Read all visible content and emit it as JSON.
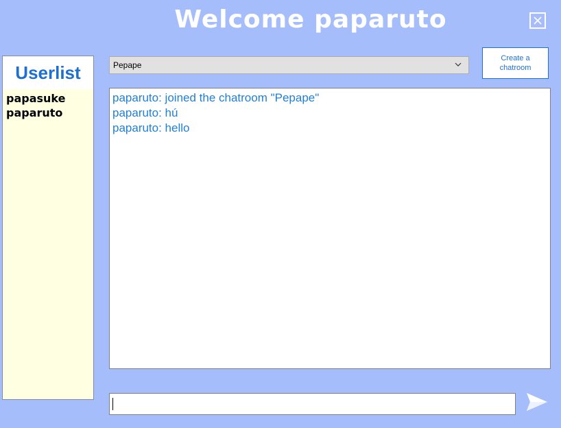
{
  "header": {
    "title": "Welcome paparuto"
  },
  "window": {
    "close_icon": "close-icon"
  },
  "userlist": {
    "title": "Userlist",
    "users": [
      "papasuke",
      "paparuto"
    ]
  },
  "chatroom_select": {
    "selected": "Pepape",
    "icon": "chevron-down-icon"
  },
  "create_button": {
    "label_line1": "Create a",
    "label_line2": "chatroom"
  },
  "messages": [
    "paparuto: joined the chatroom \"Pepape\"",
    "paparuto: hú",
    "paparuto: hello"
  ],
  "message_input": {
    "value": ""
  },
  "send": {
    "icon": "send-icon"
  },
  "colors": {
    "background": "#a6bdfc",
    "accent": "#1f6fd1",
    "message_text": "#1f7fd6",
    "userlist_bg": "#ffffe1"
  }
}
